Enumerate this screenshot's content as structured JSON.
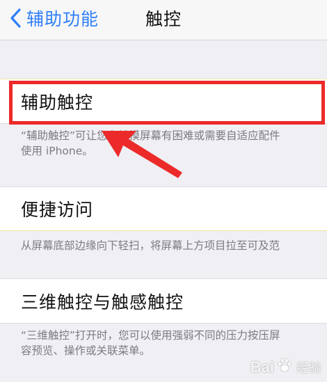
{
  "nav": {
    "back_label": "辅助功能",
    "title": "触控"
  },
  "cells": {
    "assistive_touch": {
      "label": "辅助触控",
      "footer_line1": "“辅助触控”可让您在触摸屏幕有困难或需要自适应配件",
      "footer_line2": "使用 iPhone。"
    },
    "reachability": {
      "label": "便捷访问",
      "footer_line1": "从屏幕底部边缘向下轻扫，将屏幕上方项目拉至可及范"
    },
    "three_d_touch": {
      "label": "三维触控与触感触控",
      "footer_line1": "“三维触控”打开时，您可以使用强弱不同的压力按压屏",
      "footer_line2": "容预览、操作或关联菜单。"
    }
  },
  "watermark": {
    "brand_left": "Bai",
    "brand_right": "经验"
  },
  "colors": {
    "accent_blue": "#2f7ff6",
    "highlight_red": "#ec2a2a",
    "background": "#efeff4"
  }
}
